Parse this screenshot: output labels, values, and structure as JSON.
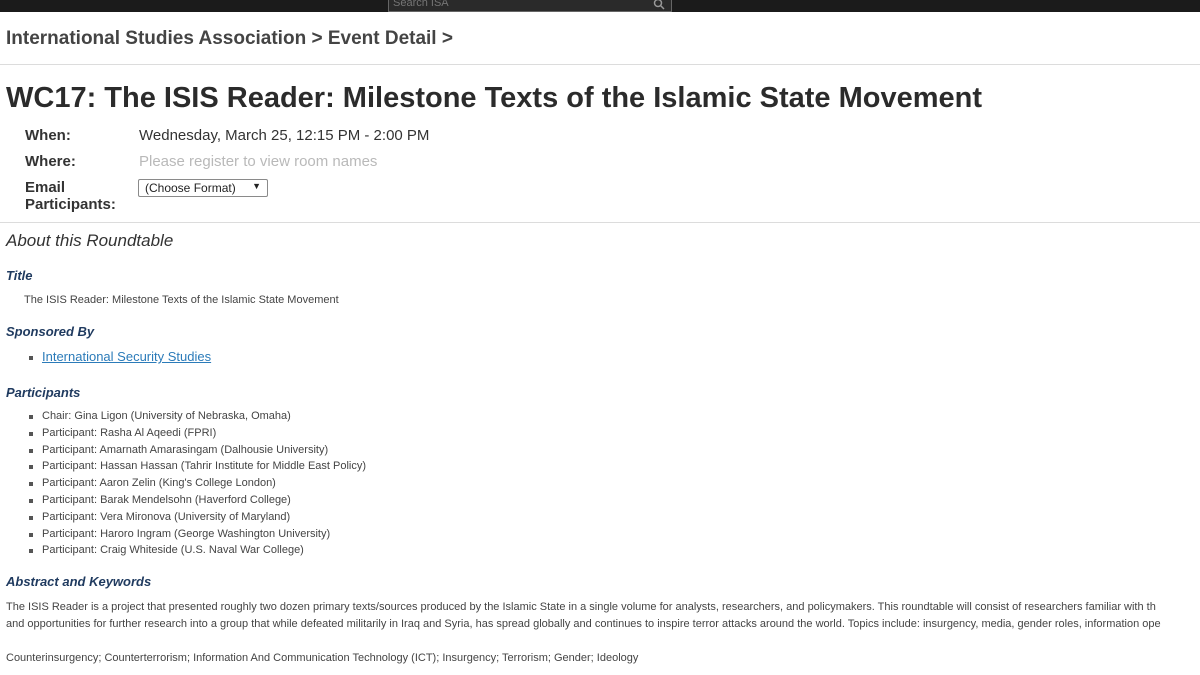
{
  "search": {
    "placeholder": "Search ISA"
  },
  "breadcrumb": "International Studies Association > Event Detail >",
  "event": {
    "title": "WC17: The ISIS Reader: Milestone Texts of the Islamic State Movement",
    "when_label": "When:",
    "when_value": "Wednesday, March 25, 12:15 PM - 2:00 PM",
    "where_label": "Where:",
    "where_value": "Please register to view room names",
    "email_label_1": "Email",
    "email_label_2": "Participants:",
    "email_select_value": "(Choose Format)"
  },
  "about_heading": "About this Roundtable",
  "sections": {
    "title_heading": "Title",
    "title_value": "The ISIS Reader: Milestone Texts of the Islamic State Movement",
    "sponsored_heading": "Sponsored By",
    "sponsor": "International Security Studies",
    "participants_heading": "Participants",
    "participants": [
      "Chair: Gina Ligon (University of Nebraska, Omaha)",
      "Participant: Rasha Al Aqeedi (FPRI)",
      "Participant: Amarnath Amarasingam (Dalhousie University)",
      "Participant: Hassan Hassan (Tahrir Institute for Middle East Policy)",
      "Participant: Aaron Zelin (King's College London)",
      "Participant: Barak Mendelsohn (Haverford College)",
      "Participant: Vera Mironova (University of Maryland)",
      "Participant: Haroro Ingram (George Washington University)",
      "Participant: Craig Whiteside (U.S. Naval War College)"
    ],
    "abstract_heading": "Abstract and Keywords",
    "abstract_line1": "The ISIS Reader is a project that presented roughly two dozen primary texts/sources produced by the Islamic State in a single volume for analysts, researchers, and policymakers. This roundtable will consist of researchers familiar with th",
    "abstract_line2": "and opportunities for further research into a group that while defeated militarily in Iraq and Syria, has spread globally and continues to inspire terror attacks around the world. Topics include: insurgency, media, gender roles, information ope",
    "keywords": "Counterinsurgency; Counterterrorism; Information And Communication Technology (ICT); Insurgency; Terrorism; Gender; Ideology"
  }
}
